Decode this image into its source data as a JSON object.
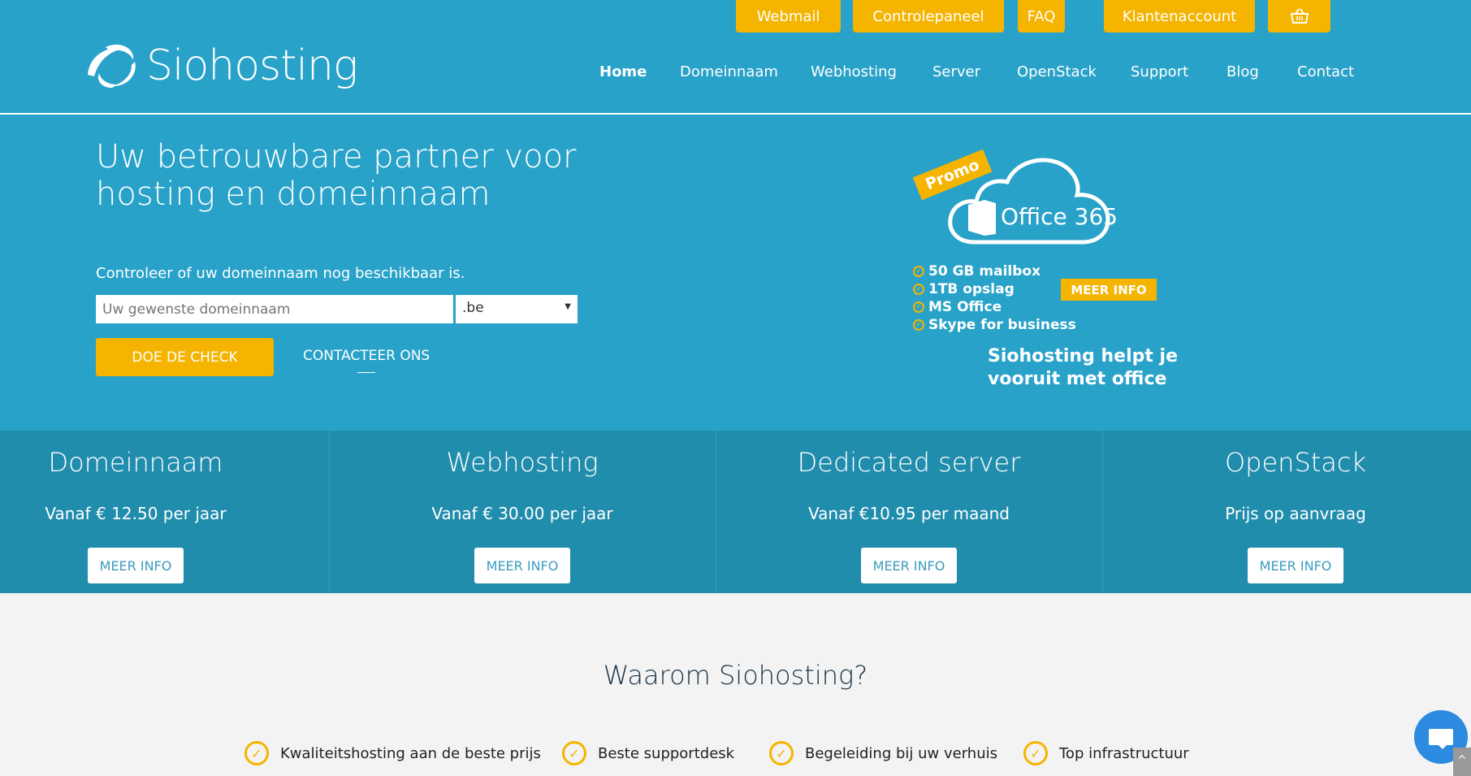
{
  "topbar": {
    "buttons": [
      "Webmail",
      "Controlepaneel",
      "FAQ",
      "Klantenaccount"
    ],
    "cart_icon": "basket-icon"
  },
  "logo": {
    "text": "Siohosting"
  },
  "nav": {
    "items": [
      "Home",
      "Domeinnaam",
      "Webhosting",
      "Server",
      "OpenStack",
      "Support",
      "Blog",
      "Contact"
    ],
    "active": "Home"
  },
  "hero": {
    "headline": "Uw betrouwbare partner voor hosting en domeinnaam",
    "check_label": "Controleer of uw domeinnaam nog beschikbaar is.",
    "domain_placeholder": "Uw gewenste domeinnaam",
    "tld_selected": ".be",
    "check_button": "DOE DE CHECK",
    "contact_button": "CONTACTEER ONS"
  },
  "promo": {
    "tag": "Promo",
    "product": "Office 365",
    "features": [
      "50 GB mailbox",
      "1TB opslag",
      "MS Office",
      "Skype for business"
    ],
    "button": "MEER INFO",
    "slogan_line1": "Siohosting helpt je",
    "slogan_line2": "vooruit met office"
  },
  "services": [
    {
      "title": "Domeinnaam",
      "price": "Vanaf € 12.50 per jaar",
      "button": "MEER INFO"
    },
    {
      "title": "Webhosting",
      "price": "Vanaf € 30.00 per jaar",
      "button": "MEER INFO"
    },
    {
      "title": "Dedicated server",
      "price": "Vanaf €10.95 per maand",
      "button": "MEER INFO"
    },
    {
      "title": "OpenStack",
      "price": "Prijs op aanvraag",
      "button": "MEER INFO"
    }
  ],
  "why": {
    "title": "Waarom Siohosting?",
    "features": [
      "Kwaliteitshosting aan de beste prijs",
      "Beste supportdesk",
      "Begeleiding bij uw verhuis",
      "Top infrastructuur"
    ]
  },
  "colors": {
    "header": "#28a2c9",
    "band": "#218dad",
    "accent": "#f5b400",
    "chat": "#2c8be0"
  }
}
